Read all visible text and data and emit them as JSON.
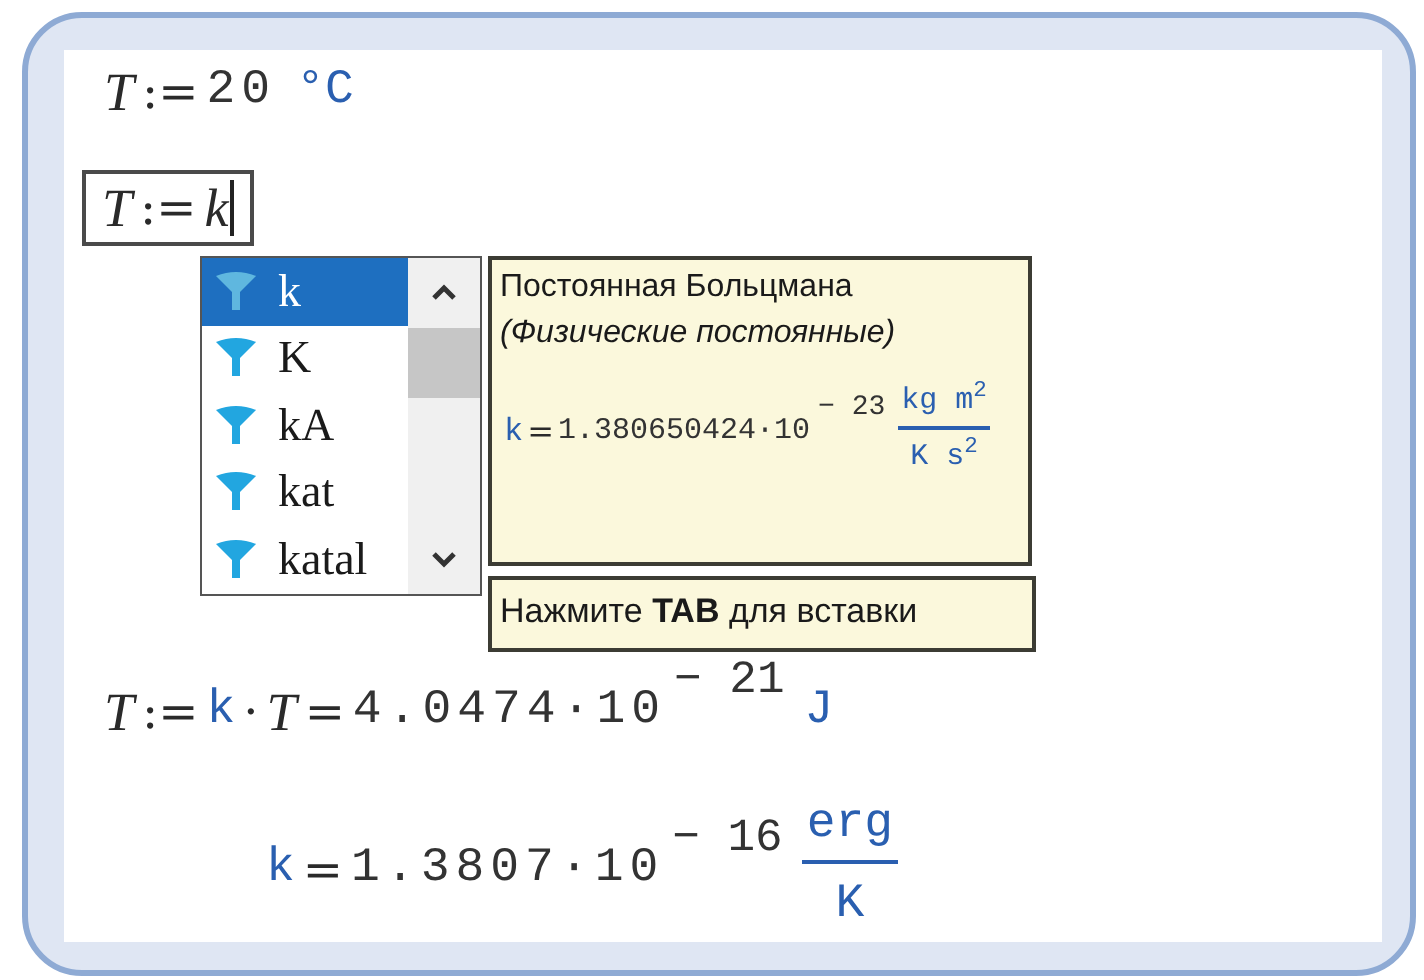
{
  "worksheet": {
    "expressions": [
      {
        "kind": "definition",
        "cursor": false,
        "tokens": [
          {
            "kind": "var",
            "text": "T"
          },
          {
            "kind": "op",
            "text": ":="
          },
          {
            "kind": "num",
            "text": "20"
          },
          {
            "kind": "unit",
            "text": "°C"
          }
        ]
      },
      {
        "kind": "editing",
        "cursor": true,
        "tokens": [
          {
            "kind": "var",
            "text": "T"
          },
          {
            "kind": "op",
            "text": ":="
          },
          {
            "kind": "var",
            "text": "k"
          }
        ]
      },
      {
        "kind": "result",
        "cursor": false,
        "tokens": [
          {
            "kind": "var",
            "text": "T"
          },
          {
            "kind": "op",
            "text": ":="
          },
          {
            "kind": "const",
            "text": "k"
          },
          {
            "kind": "op",
            "text": "·"
          },
          {
            "kind": "var",
            "text": "T"
          },
          {
            "kind": "op",
            "text": "="
          },
          {
            "kind": "num",
            "text": "4.0474·10"
          },
          {
            "kind": "exp",
            "text": "− 21"
          },
          {
            "kind": "unit",
            "text": "J"
          }
        ]
      },
      {
        "kind": "result",
        "cursor": false,
        "tokens": [
          {
            "kind": "const",
            "text": "k"
          },
          {
            "kind": "op",
            "text": "="
          },
          {
            "kind": "num",
            "text": "1.3807·10"
          },
          {
            "kind": "exp",
            "text": "− 16"
          },
          {
            "kind": "frac",
            "numerator": "erg",
            "denominator": "K"
          }
        ]
      }
    ]
  },
  "autocomplete": {
    "items": [
      {
        "label": "k",
        "selected": true
      },
      {
        "label": "K",
        "selected": false
      },
      {
        "label": "kA",
        "selected": false
      },
      {
        "label": "kat",
        "selected": false
      },
      {
        "label": "katal",
        "selected": false
      }
    ]
  },
  "tooltip": {
    "title": "Постоянная Больцмана *(Физические постоянные)*",
    "formula": [
      {
        "kind": "const",
        "text": "k"
      },
      {
        "kind": "op",
        "text": "="
      },
      {
        "kind": "num",
        "text": "1.380650424·10"
      },
      {
        "kind": "exp",
        "text": "− 23"
      },
      {
        "kind": "frac",
        "numerator": "kg m$^{2}$",
        "denominator": "K s$^{2}$"
      }
    ]
  },
  "hint": "Нажмите **TAB** для вставки"
}
